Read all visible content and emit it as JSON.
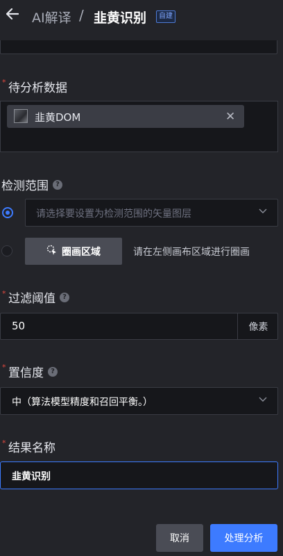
{
  "header": {
    "back_icon": "arrow-left-icon",
    "breadcrumb_parent": "AI解译",
    "separator": "/",
    "title": "韭黄识别",
    "badge": "自建"
  },
  "data_section": {
    "label": "待分析数据",
    "chip": {
      "name": "韭黄DOM",
      "icon": "raster-thumbnail-icon",
      "close_icon": "close-icon"
    }
  },
  "detect_range": {
    "label": "检测范围",
    "help_icon": "help-icon",
    "option_layer": {
      "selected": true,
      "placeholder": "请选择要设置为检测范围的矢量图层"
    },
    "option_draw": {
      "selected": false,
      "button_label": "圈画区域",
      "button_icon": "cursor-draw-icon",
      "hint": "请在左侧画布区域进行圈画"
    }
  },
  "threshold": {
    "label": "过滤阈值",
    "help_icon": "help-icon",
    "value": "50",
    "unit": "像素"
  },
  "confidence": {
    "label": "置信度",
    "help_icon": "help-icon",
    "selected": "中（算法模型精度和召回平衡。）"
  },
  "result_name": {
    "label": "结果名称",
    "value": "韭黄识别"
  },
  "footer": {
    "cancel_label": "取消",
    "submit_label": "处理分析"
  },
  "colors": {
    "background": "#232429",
    "accent": "#3d7bff",
    "required": "#e0483e",
    "field_bg": "#16171b"
  }
}
